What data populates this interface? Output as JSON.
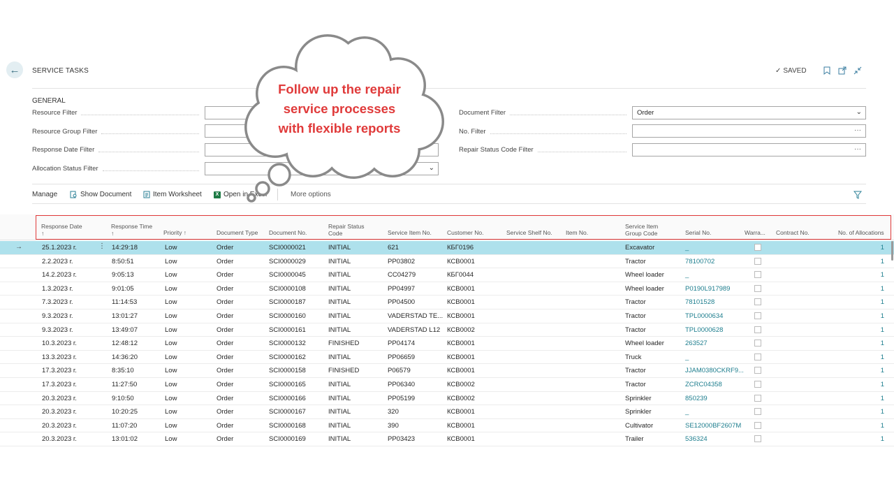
{
  "header": {
    "title": "SERVICE TASKS",
    "saved": "SAVED"
  },
  "general": {
    "title": "GENERAL",
    "left_filters": [
      {
        "label": "Resource Filter",
        "value": "",
        "control": "ellipsis"
      },
      {
        "label": "Resource Group Filter",
        "value": "",
        "control": "ellipsis"
      },
      {
        "label": "Response Date Filter",
        "value": "",
        "control": "none"
      },
      {
        "label": "Allocation Status Filter",
        "value": "",
        "control": "dropdown"
      }
    ],
    "right_filters": [
      {
        "label": "Document Filter",
        "value": "Order",
        "control": "dropdown"
      },
      {
        "label": "No. Filter",
        "value": "",
        "control": "ellipsis"
      },
      {
        "label": "Repair Status Code Filter",
        "value": "",
        "control": "ellipsis"
      }
    ]
  },
  "actions": {
    "manage": "Manage",
    "show_document": "Show Document",
    "item_worksheet": "Item Worksheet",
    "open_in_excel": "Open in Excel",
    "more_options": "More options"
  },
  "callout": {
    "line1": "Follow up the repair",
    "line2": "service processes",
    "line3": "with flexible reports"
  },
  "table": {
    "columns": {
      "response_date": "Response Date",
      "response_date_sort": "↑",
      "response_time": "Response Time",
      "response_time_sort": "↑",
      "priority": "Priority ↑",
      "document_type": "Document Type",
      "document_no": "Document No.",
      "repair_status_1": "Repair Status",
      "repair_status_2": "Code",
      "service_item_no": "Service Item No.",
      "customer_no": "Customer No.",
      "service_shelf_no": "Service Shelf No.",
      "item_no": "Item No.",
      "service_item_group_1": "Service Item",
      "service_item_group_2": "Group Code",
      "serial_no": "Serial No.",
      "warranty": "Warra...",
      "contract_no": "Contract No.",
      "allocations": "No. of Allocations"
    },
    "rows": [
      {
        "date": "25.1.2023 г.",
        "time": "14:29:18",
        "priority": "Low",
        "doc_type": "Order",
        "doc_no": "SCI0000021",
        "status": "INITIAL",
        "service_item": "621",
        "customer": "КБГ0196",
        "group": "Excavator",
        "serial": "_",
        "alloc": "1"
      },
      {
        "date": "2.2.2023 г.",
        "time": "8:50:51",
        "priority": "Low",
        "doc_type": "Order",
        "doc_no": "SCI0000029",
        "status": "INITIAL",
        "service_item": "PP03802",
        "customer": "КСВ0001",
        "group": "Tractor",
        "serial": "78100702",
        "alloc": "1"
      },
      {
        "date": "14.2.2023 г.",
        "time": "9:05:13",
        "priority": "Low",
        "doc_type": "Order",
        "doc_no": "SCI0000045",
        "status": "INITIAL",
        "service_item": "CC04279",
        "customer": "КБГ0044",
        "group": "Wheel loader",
        "serial": "_",
        "alloc": "1"
      },
      {
        "date": "1.3.2023 г.",
        "time": "9:01:05",
        "priority": "Low",
        "doc_type": "Order",
        "doc_no": "SCI0000108",
        "status": "INITIAL",
        "service_item": "PP04997",
        "customer": "КСВ0001",
        "group": "Wheel loader",
        "serial": "P0190L917989",
        "alloc": "1"
      },
      {
        "date": "7.3.2023 г.",
        "time": "11:14:53",
        "priority": "Low",
        "doc_type": "Order",
        "doc_no": "SCI0000187",
        "status": "INITIAL",
        "service_item": "PP04500",
        "customer": "КСВ0001",
        "group": "Tractor",
        "serial": "78101528",
        "alloc": "1"
      },
      {
        "date": "9.3.2023 г.",
        "time": "13:01:27",
        "priority": "Low",
        "doc_type": "Order",
        "doc_no": "SCI0000160",
        "status": "INITIAL",
        "service_item": "VADERSTAD TE...",
        "customer": "КСВ0001",
        "group": "Tractor",
        "serial": "TPL0000634",
        "alloc": "1"
      },
      {
        "date": "9.3.2023 г.",
        "time": "13:49:07",
        "priority": "Low",
        "doc_type": "Order",
        "doc_no": "SCI0000161",
        "status": "INITIAL",
        "service_item": "VADERSTAD L12",
        "customer": "КСВ0002",
        "group": "Tractor",
        "serial": "TPL0000628",
        "alloc": "1"
      },
      {
        "date": "10.3.2023 г.",
        "time": "12:48:12",
        "priority": "Low",
        "doc_type": "Order",
        "doc_no": "SCI0000132",
        "status": "FINISHED",
        "service_item": "PP04174",
        "customer": "КСВ0001",
        "group": "Wheel loader",
        "serial": "263527",
        "alloc": "1"
      },
      {
        "date": "13.3.2023 г.",
        "time": "14:36:20",
        "priority": "Low",
        "doc_type": "Order",
        "doc_no": "SCI0000162",
        "status": "INITIAL",
        "service_item": "PP06659",
        "customer": "КСВ0001",
        "group": "Truck",
        "serial": "_",
        "alloc": "1"
      },
      {
        "date": "17.3.2023 г.",
        "time": "8:35:10",
        "priority": "Low",
        "doc_type": "Order",
        "doc_no": "SCI0000158",
        "status": "FINISHED",
        "service_item": "P06579",
        "customer": "КСВ0001",
        "group": "Tractor",
        "serial": "JJAM0380CKRF9...",
        "alloc": "1"
      },
      {
        "date": "17.3.2023 г.",
        "time": "11:27:50",
        "priority": "Low",
        "doc_type": "Order",
        "doc_no": "SCI0000165",
        "status": "INITIAL",
        "service_item": "PP06340",
        "customer": "КСВ0002",
        "group": "Tractor",
        "serial": "ZCRC04358",
        "alloc": "1"
      },
      {
        "date": "20.3.2023 г.",
        "time": "9:10:50",
        "priority": "Low",
        "doc_type": "Order",
        "doc_no": "SCI0000166",
        "status": "INITIAL",
        "service_item": "PP05199",
        "customer": "КСВ0002",
        "group": "Sprinkler",
        "serial": "850239",
        "alloc": "1"
      },
      {
        "date": "20.3.2023 г.",
        "time": "10:20:25",
        "priority": "Low",
        "doc_type": "Order",
        "doc_no": "SCI0000167",
        "status": "INITIAL",
        "service_item": "320",
        "customer": "КСВ0001",
        "group": "Sprinkler",
        "serial": "_",
        "alloc": "1"
      },
      {
        "date": "20.3.2023 г.",
        "time": "11:07:20",
        "priority": "Low",
        "doc_type": "Order",
        "doc_no": "SCI0000168",
        "status": "INITIAL",
        "service_item": "390",
        "customer": "КСВ0001",
        "group": "Cultivator",
        "serial": "SE12000BF2607M",
        "alloc": "1"
      },
      {
        "date": "20.3.2023 г.",
        "time": "13:01:02",
        "priority": "Low",
        "doc_type": "Order",
        "doc_no": "SCI0000169",
        "status": "INITIAL",
        "service_item": "PP03423",
        "customer": "КСВ0001",
        "group": "Trailer",
        "serial": "536324",
        "alloc": "1"
      }
    ]
  }
}
